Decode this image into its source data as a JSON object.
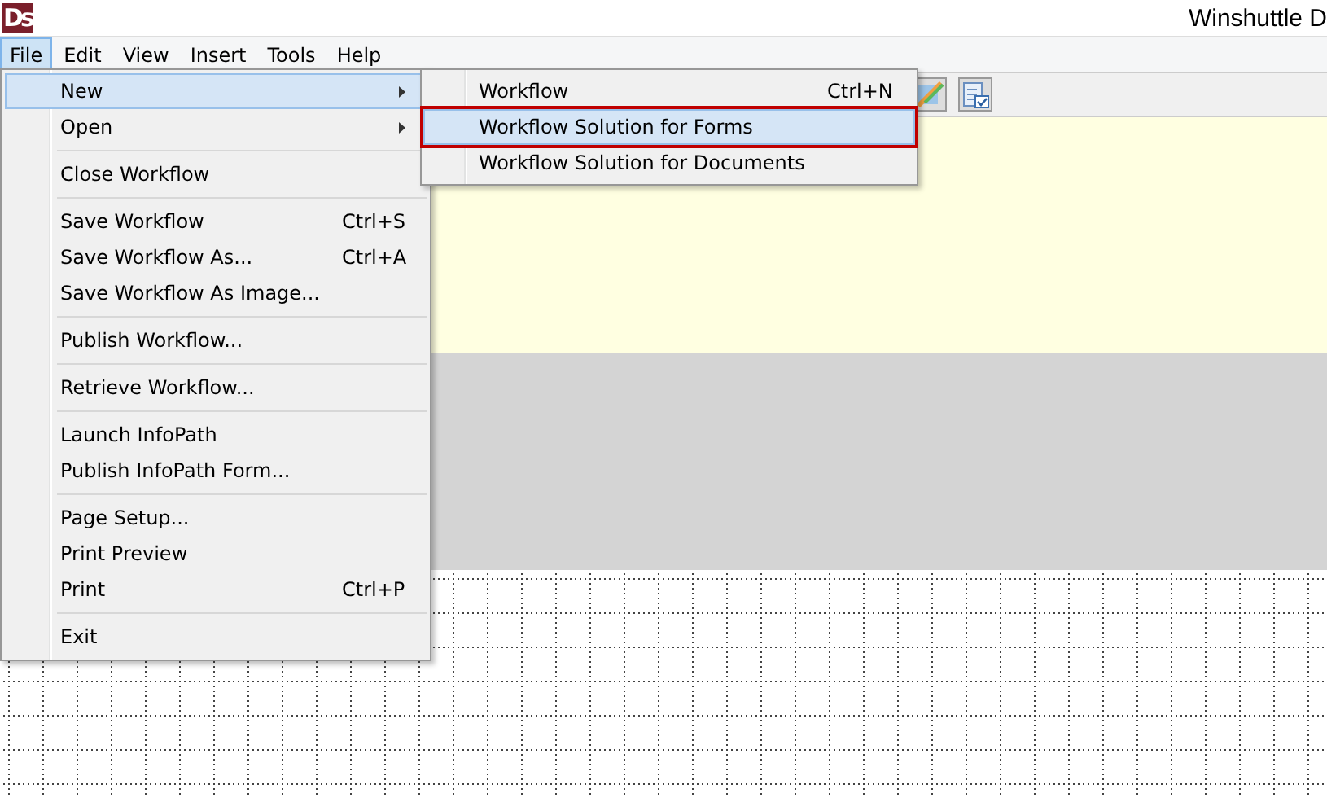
{
  "window": {
    "logo": "Ds",
    "title": "Winshuttle D"
  },
  "menubar": [
    {
      "label": "File",
      "selected": true
    },
    {
      "label": "Edit",
      "selected": false
    },
    {
      "label": "View",
      "selected": false
    },
    {
      "label": "Insert",
      "selected": false
    },
    {
      "label": "Tools",
      "selected": false
    },
    {
      "label": "Help",
      "selected": false
    }
  ],
  "file_menu": [
    {
      "kind": "item",
      "label": "New",
      "has_submenu": true,
      "selected": true
    },
    {
      "kind": "item",
      "label": "Open",
      "has_submenu": true,
      "selected": false
    },
    {
      "kind": "separator"
    },
    {
      "kind": "item",
      "label": "Close Workflow",
      "selected": false
    },
    {
      "kind": "separator"
    },
    {
      "kind": "item",
      "label": "Save Workflow",
      "shortcut": "Ctrl+S",
      "selected": false
    },
    {
      "kind": "item",
      "label": "Save Workflow As...",
      "shortcut": "Ctrl+A",
      "selected": false
    },
    {
      "kind": "item",
      "label": "Save Workflow As Image...",
      "selected": false
    },
    {
      "kind": "separator"
    },
    {
      "kind": "item",
      "label": "Publish Workflow...",
      "selected": false
    },
    {
      "kind": "separator"
    },
    {
      "kind": "item",
      "label": "Retrieve Workflow...",
      "selected": false
    },
    {
      "kind": "separator"
    },
    {
      "kind": "item",
      "label": "Launch InfoPath",
      "selected": false
    },
    {
      "kind": "item",
      "label": "Publish InfoPath Form...",
      "selected": false
    },
    {
      "kind": "separator"
    },
    {
      "kind": "item",
      "label": "Page Setup...",
      "selected": false
    },
    {
      "kind": "item",
      "label": "Print Preview",
      "selected": false
    },
    {
      "kind": "item",
      "label": "Print",
      "shortcut": "Ctrl+P",
      "selected": false
    },
    {
      "kind": "separator"
    },
    {
      "kind": "item",
      "label": "Exit",
      "selected": false
    }
  ],
  "new_submenu": [
    {
      "label": "Workflow",
      "shortcut": "Ctrl+N",
      "selected": false,
      "outlined": false
    },
    {
      "label": "Workflow Solution for Forms",
      "selected": true,
      "outlined": true
    },
    {
      "label": "Workflow Solution for Documents",
      "selected": false,
      "outlined": false
    }
  ]
}
